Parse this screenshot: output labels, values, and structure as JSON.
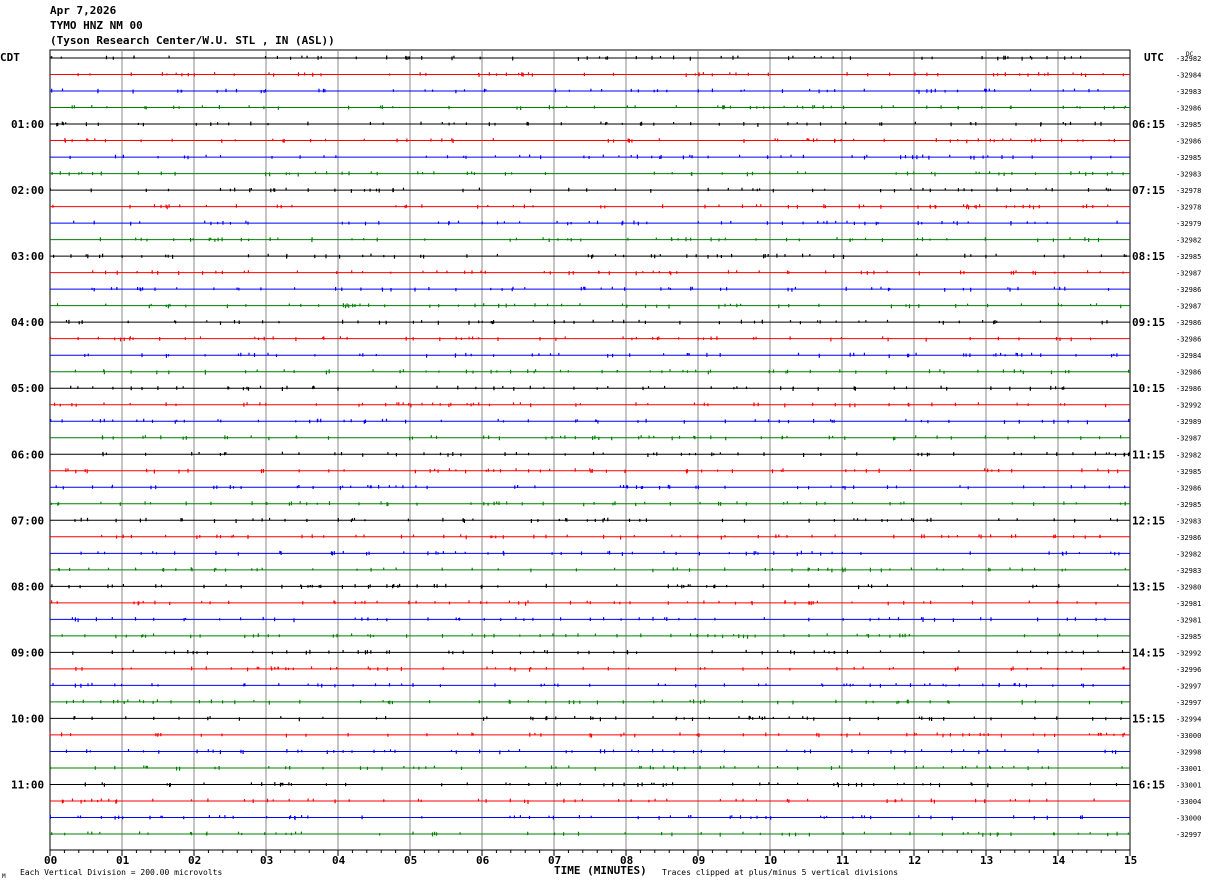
{
  "header": {
    "date": "Apr 7,2026",
    "station": "TYMO HNZ NM 00",
    "location": "(Tyson Research Center/W.U. STL , IN (ASL))"
  },
  "left_axis_title": "CDT",
  "right_axis_title": "UTC",
  "dc_title": "DC",
  "footer": {
    "scale": "Each Vertical Division =  200.00 microvolts",
    "xlabel": "TIME (MINUTES)",
    "clip_note": "Traces clipped at plus/minus 5 vertical divisions",
    "corner_mark": "M"
  },
  "colors": [
    "#000000",
    "#ff0000",
    "#0000ff",
    "#008000"
  ],
  "chart_data": {
    "type": "line",
    "title": "TYMO HNZ NM 00 helicorder",
    "xlabel": "TIME (MINUTES)",
    "xlim": [
      0,
      15
    ],
    "x_ticks": [
      "00",
      "01",
      "02",
      "03",
      "04",
      "05",
      "06",
      "07",
      "08",
      "09",
      "10",
      "11",
      "12",
      "13",
      "14",
      "15"
    ],
    "rows_per_hour": 4,
    "left_hour_labels": [
      "01:00",
      "02:00",
      "03:00",
      "04:00",
      "05:00",
      "06:00",
      "07:00",
      "08:00",
      "09:00",
      "10:00",
      "11:00"
    ],
    "right_hour_labels": [
      "06:15",
      "07:15",
      "08:15",
      "09:15",
      "10:15",
      "11:15",
      "12:15",
      "13:15",
      "14:15",
      "15:15",
      "16:15"
    ],
    "dc_offsets": [
      -32982,
      -32984,
      -32983,
      -32986,
      -32985,
      -32986,
      -32985,
      -32983,
      -32978,
      -32978,
      -32979,
      -32982,
      -32985,
      -32987,
      -32986,
      -32987,
      -32986,
      -32986,
      -32984,
      -32986,
      -32986,
      -32992,
      -32989,
      -32987,
      -32982,
      -32985,
      -32986,
      -32985,
      -32983,
      -32986,
      -32982,
      -32983,
      -32980,
      -32981,
      -32981,
      -32985,
      -32992,
      -32996,
      -32997,
      -32997,
      -32994,
      -33000,
      -32998,
      -33001,
      -33001,
      -33004,
      -33000,
      -32997
    ]
  }
}
